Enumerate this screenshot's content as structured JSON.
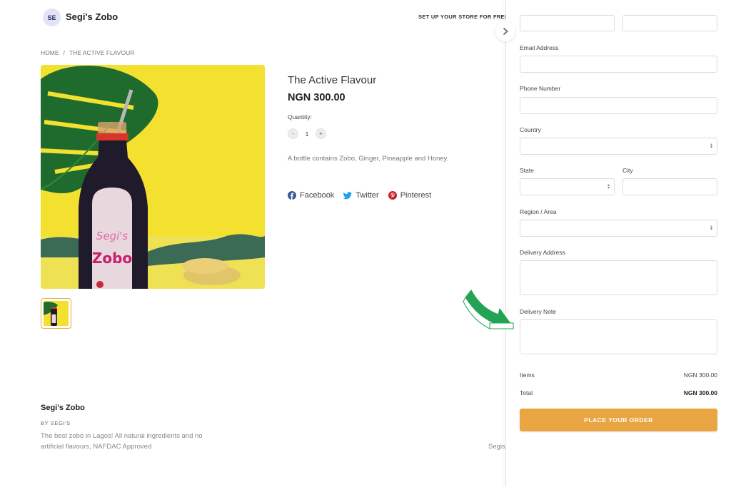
{
  "header": {
    "avatar_initials": "SE",
    "store_name": "Segi's Zobo",
    "setup_link": "SET UP YOUR STORE FOR FREE"
  },
  "breadcrumb": {
    "items": [
      "HOME",
      "/",
      "THE ACTIVE FLAVOUR"
    ]
  },
  "product": {
    "title": "The Active Flavour",
    "price": "NGN 300.00",
    "quantity_label": "Quantity:",
    "quantity_value": "1",
    "decrement_label": "-",
    "increment_label": "+",
    "description": "A bottle contains Zobo, Ginger, Pineapple and Honey.",
    "label_brand": "Segi's",
    "label_product": "Zobo",
    "share": [
      {
        "label": "Facebook",
        "icon": "facebook-icon",
        "color": "#3b5998"
      },
      {
        "label": "Twitter",
        "icon": "twitter-icon",
        "color": "#1da1f2"
      },
      {
        "label": "Pinterest",
        "icon": "pinterest-icon",
        "color": "#cb2027"
      }
    ]
  },
  "footer": {
    "title": "Segi's Zobo",
    "by": "BY SEGI'S",
    "description": "The best zobo in Lagos! All natural ingredients and no artificial flavours, NAFDAC Approved",
    "right_text": "Segis"
  },
  "checkout": {
    "fields": {
      "first_name": {
        "label": "",
        "value": ""
      },
      "last_name": {
        "label": "",
        "value": ""
      },
      "email": {
        "label": "Email Address",
        "value": ""
      },
      "phone": {
        "label": "Phone Number",
        "value": ""
      },
      "country": {
        "label": "Country",
        "value": ""
      },
      "state": {
        "label": "State",
        "value": ""
      },
      "city": {
        "label": "City",
        "value": ""
      },
      "region": {
        "label": "Region / Area",
        "value": ""
      },
      "delivery_address": {
        "label": "Delivery Address",
        "value": ""
      },
      "delivery_note": {
        "label": "Delivery Note",
        "value": ""
      }
    },
    "summary": {
      "items_label": "Items",
      "items_value": "NGN 300.00",
      "total_label": "Total",
      "total_value": "NGN 300.00"
    },
    "place_order_label": "PLACE YOUR ORDER"
  },
  "colors": {
    "accent": "#e9a542",
    "annotation_arrow": "#23a455",
    "avatar_bg": "#e2e3f5"
  }
}
